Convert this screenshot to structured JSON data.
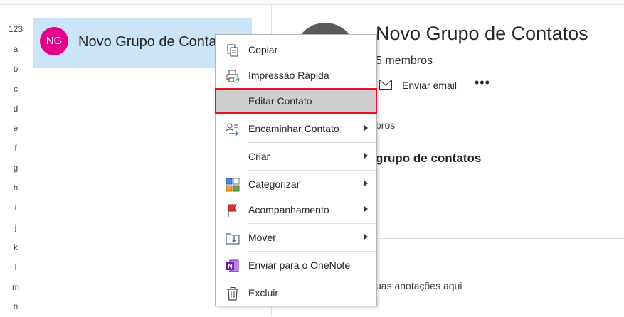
{
  "alpha_index": [
    "123",
    "a",
    "b",
    "c",
    "d",
    "e",
    "f",
    "g",
    "h",
    "i",
    "j",
    "k",
    "l",
    "m",
    "n"
  ],
  "contact_list": {
    "selected": {
      "initials": "NG",
      "name": "Novo Grupo de Contatos",
      "avatar_color": "#e3008c"
    }
  },
  "detail": {
    "title": "Novo Grupo de Contatos",
    "members": "5 membros",
    "send_email": "Enviar email",
    "more": "•••",
    "members_tab": "bros",
    "section_heading": "grupo de contatos",
    "notes_hint": "uas anotações aqui"
  },
  "context_menu": {
    "items": [
      {
        "label": "Copiar",
        "icon": "copy-icon",
        "submenu": false
      },
      {
        "label": "Impressão Rápida",
        "icon": "quick-print-icon",
        "submenu": false
      },
      {
        "label": "Editar Contato",
        "icon": "",
        "submenu": false,
        "highlighted": true
      },
      {
        "label": "Encaminhar Contato",
        "icon": "forward-contact-icon",
        "submenu": true
      },
      {
        "label": "Criar",
        "icon": "",
        "submenu": true
      },
      {
        "label": "Categorizar",
        "icon": "categorize-icon",
        "submenu": true
      },
      {
        "label": "Acompanhamento",
        "icon": "flag-icon",
        "submenu": true
      },
      {
        "label": "Mover",
        "icon": "move-icon",
        "submenu": true
      },
      {
        "label": "Enviar para o OneNote",
        "icon": "onenote-icon",
        "submenu": false
      },
      {
        "label": "Excluir",
        "icon": "delete-icon",
        "submenu": false
      }
    ]
  },
  "colors": {
    "selection": "#cce4f7",
    "highlight_border": "#e81123",
    "menu_hover": "#cfcfcf"
  }
}
